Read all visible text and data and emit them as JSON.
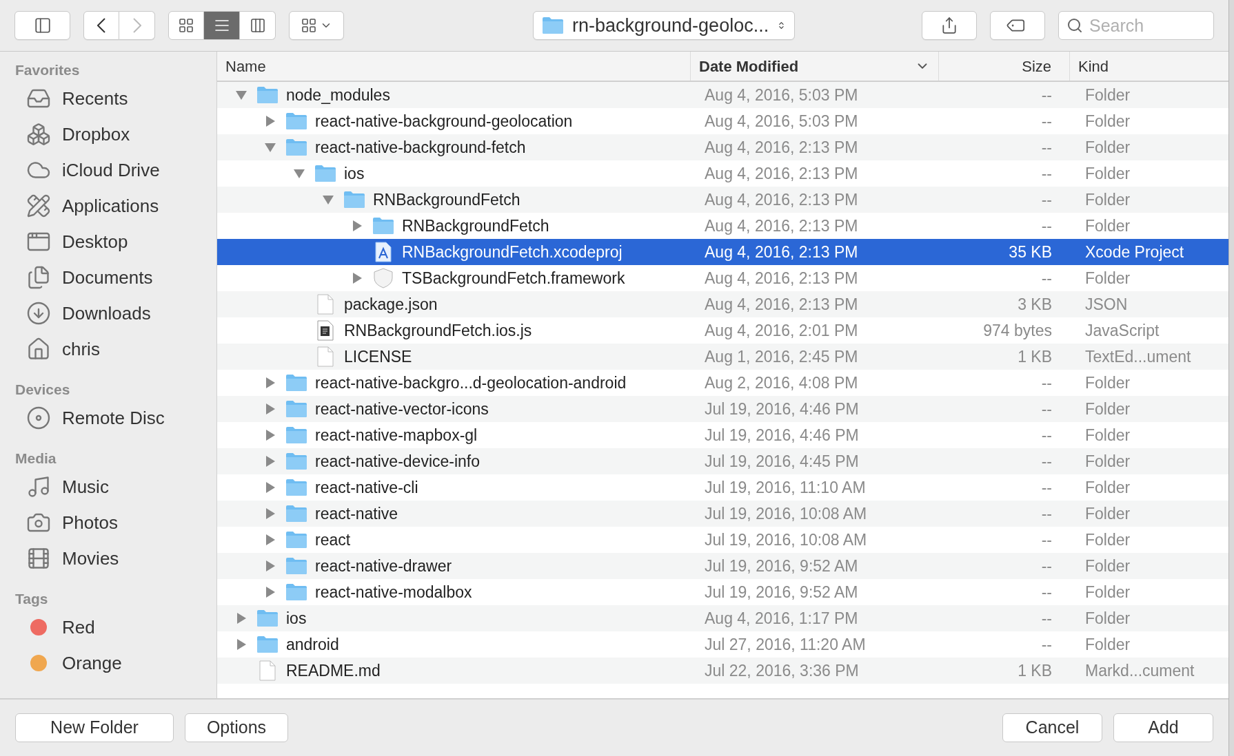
{
  "toolbar": {
    "back": {
      "disabled": false
    },
    "forward": {
      "disabled": true
    },
    "view_modes": [
      {
        "selected": false
      },
      {
        "selected": true
      },
      {
        "selected": false
      }
    ],
    "path_popup": {
      "label": "rn-background-geoloc..."
    },
    "search": {
      "placeholder": "Search"
    }
  },
  "sidebar": {
    "sections": [
      {
        "title": "Favorites",
        "items": [
          {
            "label": "Recents"
          },
          {
            "label": "Dropbox"
          },
          {
            "label": "iCloud Drive"
          },
          {
            "label": "Applications"
          },
          {
            "label": "Desktop"
          },
          {
            "label": "Documents"
          },
          {
            "label": "Downloads"
          },
          {
            "label": "chris"
          }
        ]
      },
      {
        "title": "Devices",
        "items": [
          {
            "label": "Remote Disc"
          }
        ]
      },
      {
        "title": "Media",
        "items": [
          {
            "label": "Music"
          },
          {
            "label": "Photos"
          },
          {
            "label": "Movies"
          }
        ]
      },
      {
        "title": "Tags",
        "items": [
          {
            "label": "Red",
            "color": "#ee6b62"
          },
          {
            "label": "Orange",
            "color": "#f0a74f"
          }
        ]
      }
    ]
  },
  "table": {
    "columns": [
      {
        "label": "Name",
        "sorted": false
      },
      {
        "label": "Date Modified",
        "sorted": true
      },
      {
        "label": "Size",
        "sorted": false
      },
      {
        "label": "Kind",
        "sorted": false
      }
    ],
    "rows": [
      {
        "name": "node_modules",
        "kind": "folder",
        "expanded": true,
        "date": "Aug 4, 2016, 5:03 PM",
        "size": "--",
        "kind_label": "Folder",
        "selected": false,
        "children": [
          {
            "name": "react-native-background-geolocation",
            "kind": "folder",
            "expanded": false,
            "date": "Aug 4, 2016, 5:03 PM",
            "size": "--",
            "kind_label": "Folder",
            "selected": false
          },
          {
            "name": "react-native-background-fetch",
            "kind": "folder",
            "expanded": true,
            "date": "Aug 4, 2016, 2:13 PM",
            "size": "--",
            "kind_label": "Folder",
            "selected": false,
            "children": [
              {
                "name": "ios",
                "kind": "folder",
                "expanded": true,
                "date": "Aug 4, 2016, 2:13 PM",
                "size": "--",
                "kind_label": "Folder",
                "selected": false,
                "children": [
                  {
                    "name": "RNBackgroundFetch",
                    "kind": "folder",
                    "expanded": true,
                    "date": "Aug 4, 2016, 2:13 PM",
                    "size": "--",
                    "kind_label": "Folder",
                    "selected": false,
                    "children": [
                      {
                        "name": "RNBackgroundFetch",
                        "kind": "folder",
                        "expanded": false,
                        "date": "Aug 4, 2016, 2:13 PM",
                        "size": "--",
                        "kind_label": "Folder",
                        "selected": false
                      },
                      {
                        "name": "RNBackgroundFetch.xcodeproj",
                        "kind": "project",
                        "date": "Aug 4, 2016, 2:13 PM",
                        "size": "35 KB",
                        "kind_label": "Xcode Project",
                        "selected": true
                      },
                      {
                        "name": "TSBackgroundFetch.framework",
                        "kind": "bundle",
                        "expanded": false,
                        "date": "Aug 4, 2016, 2:13 PM",
                        "size": "--",
                        "kind_label": "Folder",
                        "selected": false
                      }
                    ]
                  }
                ]
              },
              {
                "name": "package.json",
                "kind": "file",
                "date": "Aug 4, 2016, 2:13 PM",
                "size": "3 KB",
                "kind_label": "JSON",
                "selected": false
              },
              {
                "name": "RNBackgroundFetch.ios.js",
                "kind": "script",
                "date": "Aug 4, 2016, 2:01 PM",
                "size": "974 bytes",
                "kind_label": "JavaScript",
                "selected": false
              },
              {
                "name": "LICENSE",
                "kind": "file",
                "date": "Aug 1, 2016, 2:45 PM",
                "size": "1 KB",
                "kind_label": "TextEd...ument",
                "selected": false
              }
            ]
          },
          {
            "name": "react-native-backgro...d-geolocation-android",
            "kind": "folder",
            "expanded": false,
            "date": "Aug 2, 2016, 4:08 PM",
            "size": "--",
            "kind_label": "Folder",
            "selected": false
          },
          {
            "name": "react-native-vector-icons",
            "kind": "folder",
            "expanded": false,
            "date": "Jul 19, 2016, 4:46 PM",
            "size": "--",
            "kind_label": "Folder",
            "selected": false
          },
          {
            "name": "react-native-mapbox-gl",
            "kind": "folder",
            "expanded": false,
            "date": "Jul 19, 2016, 4:46 PM",
            "size": "--",
            "kind_label": "Folder",
            "selected": false
          },
          {
            "name": "react-native-device-info",
            "kind": "folder",
            "expanded": false,
            "date": "Jul 19, 2016, 4:45 PM",
            "size": "--",
            "kind_label": "Folder",
            "selected": false
          },
          {
            "name": "react-native-cli",
            "kind": "folder",
            "expanded": false,
            "date": "Jul 19, 2016, 11:10 AM",
            "size": "--",
            "kind_label": "Folder",
            "selected": false
          },
          {
            "name": "react-native",
            "kind": "folder",
            "expanded": false,
            "date": "Jul 19, 2016, 10:08 AM",
            "size": "--",
            "kind_label": "Folder",
            "selected": false
          },
          {
            "name": "react",
            "kind": "folder",
            "expanded": false,
            "date": "Jul 19, 2016, 10:08 AM",
            "size": "--",
            "kind_label": "Folder",
            "selected": false
          },
          {
            "name": "react-native-drawer",
            "kind": "folder",
            "expanded": false,
            "date": "Jul 19, 2016, 9:52 AM",
            "size": "--",
            "kind_label": "Folder",
            "selected": false
          },
          {
            "name": "react-native-modalbox",
            "kind": "folder",
            "expanded": false,
            "date": "Jul 19, 2016, 9:52 AM",
            "size": "--",
            "kind_label": "Folder",
            "selected": false
          }
        ]
      },
      {
        "name": "ios",
        "kind": "folder",
        "expanded": false,
        "date": "Aug 4, 2016, 1:17 PM",
        "size": "--",
        "kind_label": "Folder",
        "selected": false
      },
      {
        "name": "android",
        "kind": "folder",
        "expanded": false,
        "date": "Jul 27, 2016, 11:20 AM",
        "size": "--",
        "kind_label": "Folder",
        "selected": false
      },
      {
        "name": "README.md",
        "kind": "file",
        "date": "Jul 22, 2016, 3:36 PM",
        "size": "1 KB",
        "kind_label": "Markd...cument",
        "selected": false
      }
    ]
  },
  "footer": {
    "left_buttons": [
      {
        "label": "New Folder"
      },
      {
        "label": "Options"
      }
    ],
    "right_buttons": [
      {
        "label": "Cancel"
      },
      {
        "label": "Add"
      }
    ]
  }
}
